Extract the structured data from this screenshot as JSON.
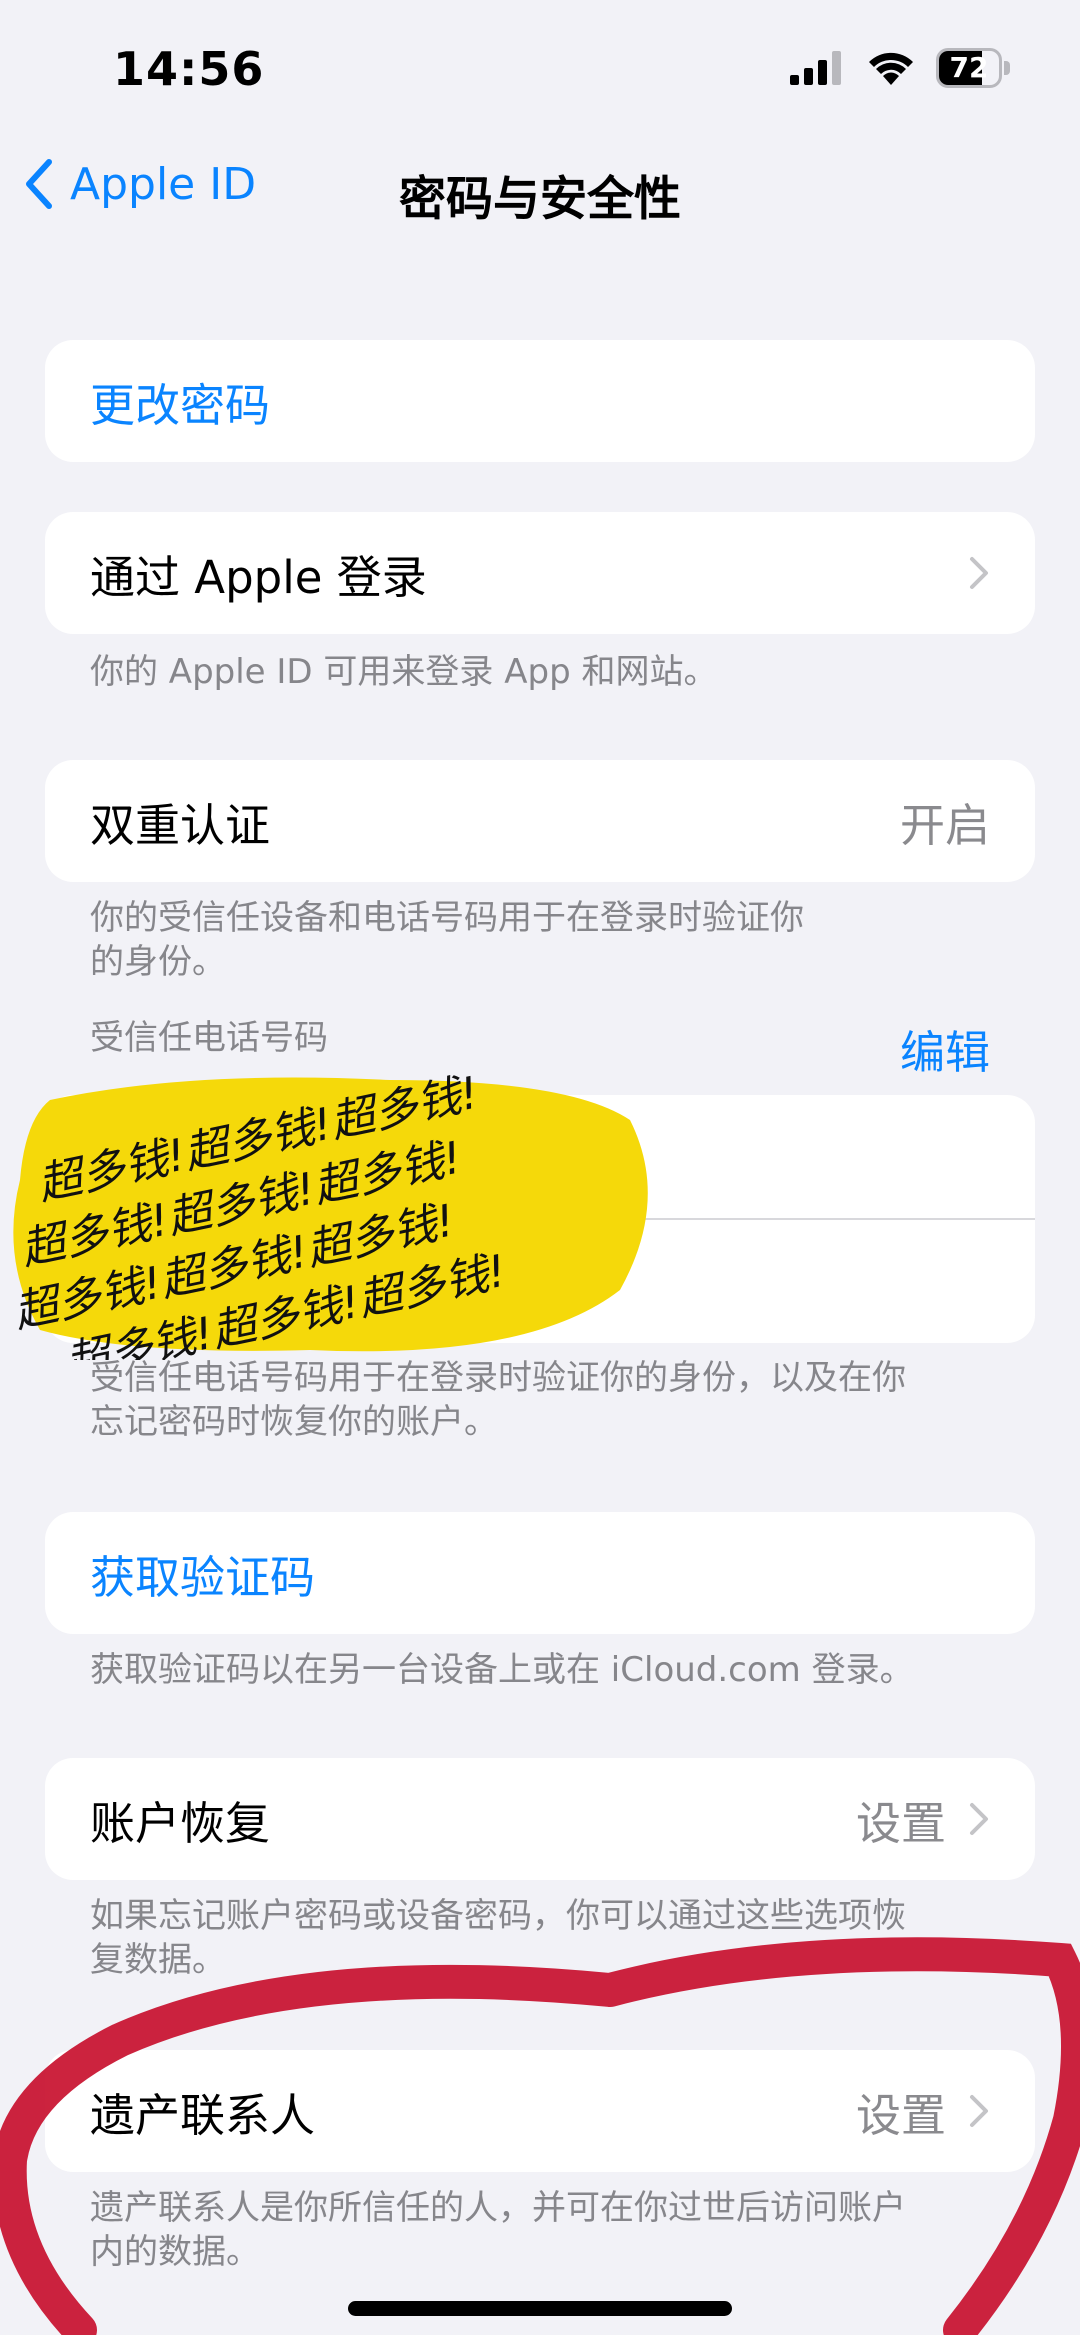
{
  "status_bar": {
    "time": "14:56",
    "battery_level": "72",
    "icons": [
      "cellular-signal-icon",
      "wifi-icon",
      "battery-icon"
    ]
  },
  "nav": {
    "back_label": "Apple ID",
    "title": "密码与安全性"
  },
  "sections": {
    "change_password": {
      "label": "更改密码"
    },
    "sign_in_with_apple": {
      "label": "通过 Apple 登录",
      "footnote": "你的 Apple ID 可用来登录 App 和网站。"
    },
    "two_factor": {
      "label": "双重认证",
      "value": "开启",
      "footnote_line1": "你的受信任设备和电话号码用于在登录时验证你",
      "footnote_line2": "的身份。"
    },
    "trusted_numbers": {
      "header": "受信任电话号码",
      "edit_label": "编辑",
      "footnote_line1": "受信任电话号码用于在登录时验证你的身份，以及在你",
      "footnote_line2": "忘记密码时恢复你的账户。"
    },
    "get_code": {
      "label": "获取验证码",
      "footnote": "获取验证码以在另一台设备上或在 iCloud.com 登录。"
    },
    "account_recovery": {
      "label": "账户恢复",
      "value": "设置",
      "footnote_line1": "如果忘记账户密码或设备密码，你可以通过这些选项恢",
      "footnote_line2": "复数据。"
    },
    "legacy_contact": {
      "label": "遗产联系人",
      "value": "设置",
      "footnote_line1": "遗产联系人是你所信任的人，并可在你过世后访问账户",
      "footnote_line2": "内的数据。"
    }
  },
  "overlay": {
    "sticker_text": "超多钱!超多钱!超多钱!",
    "sticker_color": "#F5D90A",
    "marker_color": "#C8102E"
  },
  "colors": {
    "accent": "#0A84FF",
    "background": "#F2F2F7",
    "secondary_text": "#86868B"
  }
}
